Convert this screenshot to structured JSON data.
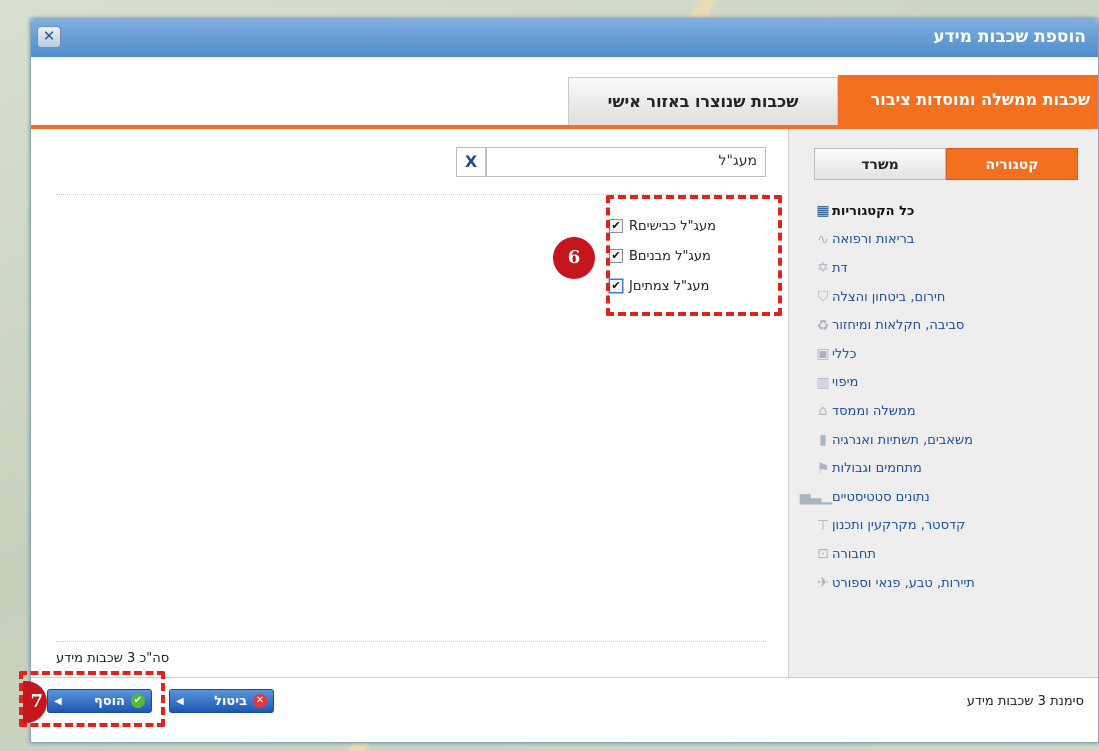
{
  "dialog": {
    "title": "הוספת שכבות מידע",
    "close_label": "✕"
  },
  "tabs": [
    {
      "label": "שכבות ממשלה ומוסדות ציבור",
      "active": true
    },
    {
      "label": "שכבות שנוצרו באזור אישי",
      "active": false
    }
  ],
  "sidebar": {
    "segments": [
      {
        "label": "קטגוריה",
        "active": true
      },
      {
        "label": "משרד",
        "active": false
      }
    ],
    "categories": [
      {
        "label": "כל הקטגוריות",
        "icon": "grid-icon"
      },
      {
        "label": "בריאות ורפואה",
        "icon": "heartbeat-icon"
      },
      {
        "label": "דת",
        "icon": "star-of-david-icon"
      },
      {
        "label": "חירום, ביטחון והצלה",
        "icon": "shield-icon"
      },
      {
        "label": "סביבה, חקלאות ומיחזור",
        "icon": "recycle-icon"
      },
      {
        "label": "כללי",
        "icon": "image-icon"
      },
      {
        "label": "מיפוי",
        "icon": "map-icon"
      },
      {
        "label": "ממשלה וממסד",
        "icon": "building-icon"
      },
      {
        "label": "משאבים, תשתיות ואנרגיה",
        "icon": "bars-icon"
      },
      {
        "label": "מתחמים וגבולות",
        "icon": "flag-icon"
      },
      {
        "label": "נתונים סטטיסטיים",
        "icon": "chart-icon"
      },
      {
        "label": "קדסטר, מקרקעין ותכנון",
        "icon": "ruler-icon"
      },
      {
        "label": "תחבורה",
        "icon": "bus-icon"
      },
      {
        "label": "תיירות, טבע, פנאי וספורט",
        "icon": "plane-icon"
      }
    ]
  },
  "search": {
    "value": "מעג\"ל",
    "clear_label": "X"
  },
  "layers": [
    {
      "code": "R",
      "label": "מעג\"ל כבישים",
      "checked": true
    },
    {
      "code": "B",
      "label": "מעג\"ל מבנים",
      "checked": true
    },
    {
      "code": "J",
      "label": "מעג\"ל צמתים",
      "checked": true
    }
  ],
  "footer": {
    "total_text": "סה\"כ 3 שכבות מידע",
    "selected_text": "סימנת 3 שכבות מידע",
    "add_label": "הוסף",
    "cancel_label": "ביטול"
  },
  "annotations": {
    "marker_6": "6",
    "marker_7": "7"
  },
  "colors": {
    "accent_orange": "#f37021",
    "title_blue": "#4f8cc8",
    "link_blue": "#1f4f9b",
    "annotation_red": "#e2231a"
  }
}
